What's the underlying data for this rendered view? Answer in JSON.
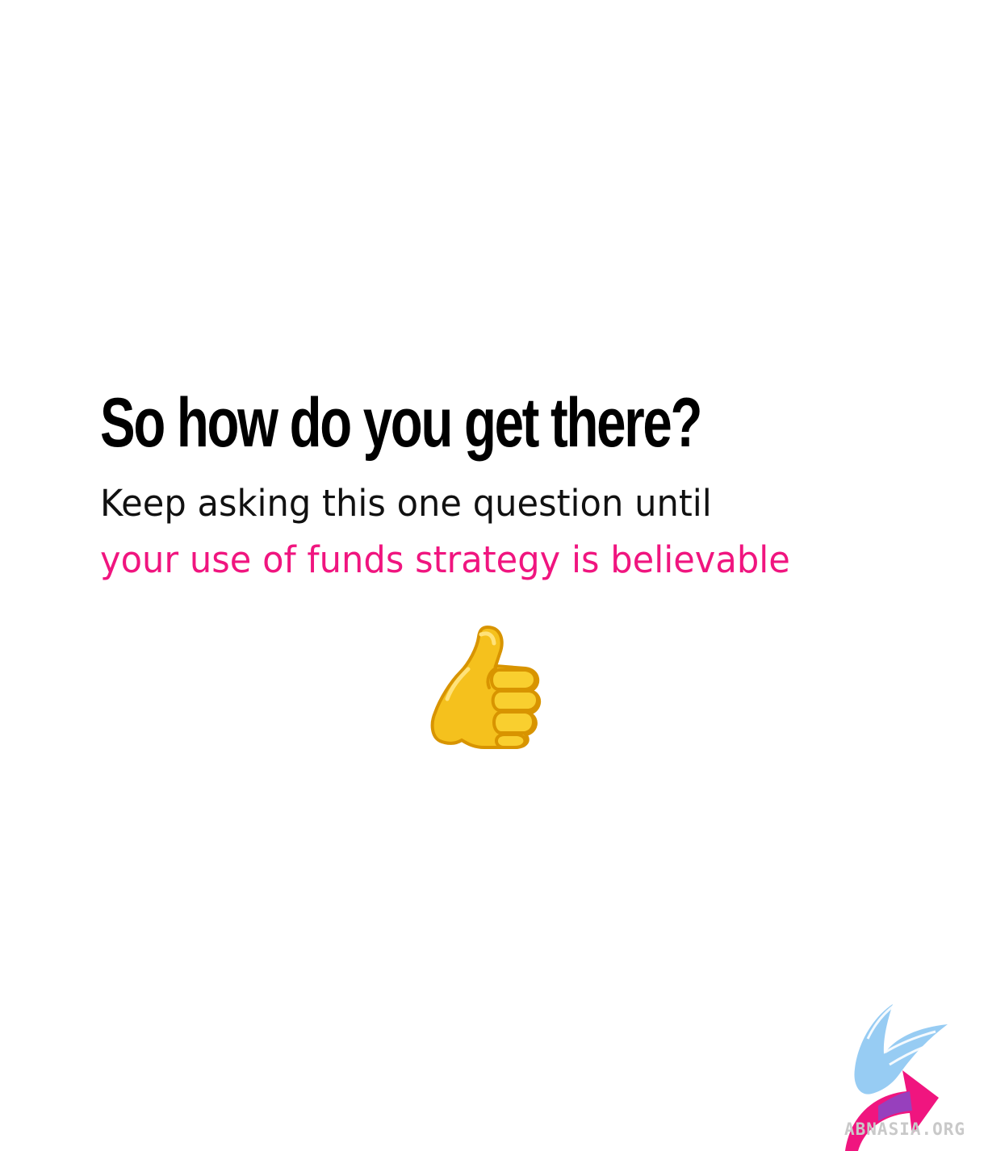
{
  "slide": {
    "headline": "So how do you get there?",
    "line_1": "Keep asking this one question until",
    "line_2": "your use of funds strategy is believable",
    "emoji_icon": "thumbs-up-icon",
    "logo": {
      "icon": "abn-asia-bird-arrow-logo",
      "text": "ABNASIA.ORG"
    }
  },
  "colors": {
    "background": "#ffffff",
    "headline": "#000000",
    "body_text": "#111111",
    "accent": "#f0157f",
    "logo_blue": "#8ec8f2",
    "logo_pink": "#f0157f",
    "logo_purple": "#7a4fd1"
  }
}
